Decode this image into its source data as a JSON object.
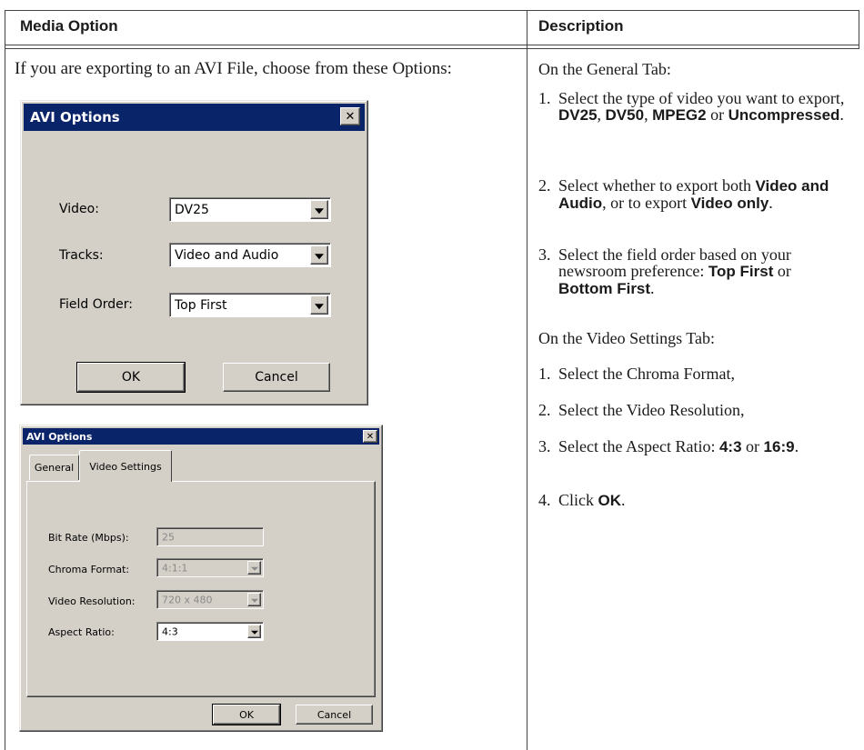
{
  "table": {
    "headers": [
      "Media Option",
      "Description"
    ]
  },
  "left": {
    "intro": "If you are exporting to an AVI File, choose from these Options:"
  },
  "dialog1": {
    "title": "AVI Options",
    "video_label": "Video:",
    "video_value": "DV25",
    "tracks_label": "Tracks:",
    "tracks_value": "Video and Audio",
    "field_order_label": "Field Order:",
    "field_order_value": "Top First",
    "ok": "OK",
    "cancel": "Cancel",
    "close_glyph": "✕"
  },
  "dialog2": {
    "title": "AVI Options",
    "tabs": [
      "General",
      "Video Settings"
    ],
    "bit_rate_label": "Bit Rate (Mbps):",
    "bit_rate_value": "25",
    "chroma_label": "Chroma Format:",
    "chroma_value": "4:1:1",
    "resolution_label": "Video Resolution:",
    "resolution_value": "720 x 480",
    "aspect_label": "Aspect Ratio:",
    "aspect_value": "4:3",
    "ok": "OK",
    "cancel": "Cancel",
    "close_glyph": "✕"
  },
  "right": {
    "general_heading": "On the General Tab:",
    "g1": {
      "num": "1.",
      "t1": "Select the type of video you want to export,",
      "b1": "DV25",
      "t2": ",",
      "b2": "DV50",
      "t3": ",",
      "b3": "MPEG2",
      "t4": "or",
      "b4": "Uncompressed",
      "t5": "."
    },
    "g2": {
      "num": "2.",
      "t1": "Select whether to export both",
      "b1": "Video and Audio",
      "t2": ", or to export",
      "b2": "Video only",
      "t3": "."
    },
    "g3": {
      "num": "3.",
      "t1": "Select the field order based on your newsroom preference:",
      "b1": "Top First",
      "t2": "or",
      "b2": "Bottom First",
      "t3": "."
    },
    "video_heading": "On the Video Settings Tab:",
    "v1": {
      "num": "1.",
      "t1": "Select the Chroma Format,"
    },
    "v2": {
      "num": "2.",
      "t1": "Select the Video Resolution,"
    },
    "v3": {
      "num": "3.",
      "t1": "Select the Aspect Ratio:",
      "b1": "4:3",
      "t2": "or",
      "b2": "16:9",
      "t3": "."
    },
    "v4": {
      "num": "4.",
      "t1": "Click",
      "b1": "OK",
      "t2": "."
    }
  }
}
